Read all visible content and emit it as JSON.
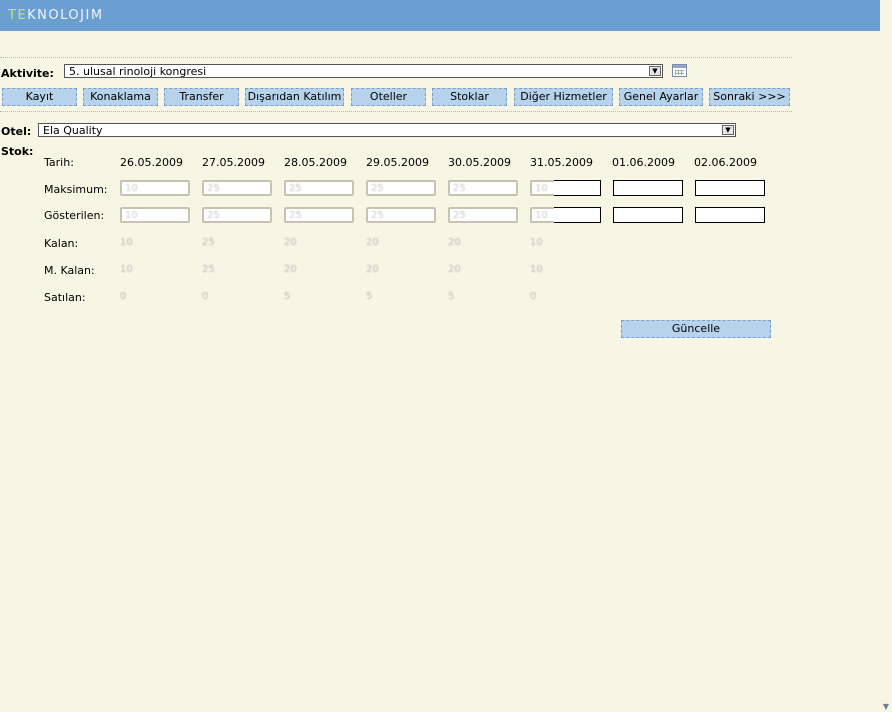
{
  "brand": {
    "logo_prefix": "TE",
    "logo_rest": "KNOLOJIM"
  },
  "activity": {
    "label": "Aktivite:",
    "value": "5. ulusal rinoloji kongresi"
  },
  "nav": [
    {
      "label": "Kayıt"
    },
    {
      "label": "Konaklama"
    },
    {
      "label": "Transfer"
    },
    {
      "label": "Dışarıdan Katılım"
    },
    {
      "label": "Oteller"
    },
    {
      "label": "Stoklar"
    },
    {
      "label": "Diğer Hizmetler"
    },
    {
      "label": "Genel Ayarlar"
    },
    {
      "label": "Sonraki >>>"
    }
  ],
  "hotel": {
    "label": "Otel:",
    "value": "Ela Quality"
  },
  "stock": {
    "label": "Stok:",
    "row_labels": {
      "date": "Tarih:",
      "max": "Maksimum:",
      "shown": "Gösterilen:",
      "remaining": "Kalan:",
      "m_remaining": "M. Kalan:",
      "sold": "Satılan:"
    },
    "dates": [
      "26.05.2009",
      "27.05.2009",
      "28.05.2009",
      "29.05.2009",
      "30.05.2009",
      "31.05.2009",
      "01.06.2009",
      "02.06.2009"
    ],
    "max_values": [
      "10",
      "25",
      "25",
      "25",
      "25",
      "10",
      "",
      ""
    ],
    "shown_values": [
      "10",
      "25",
      "25",
      "25",
      "25",
      "10",
      "",
      ""
    ],
    "remaining": [
      "10",
      "25",
      "20",
      "20",
      "20",
      "10"
    ],
    "m_remaining": [
      "10",
      "25",
      "20",
      "20",
      "20",
      "10"
    ],
    "sold": [
      "0",
      "0",
      "5",
      "5",
      "5",
      "0"
    ]
  },
  "update_button": "Güncelle"
}
